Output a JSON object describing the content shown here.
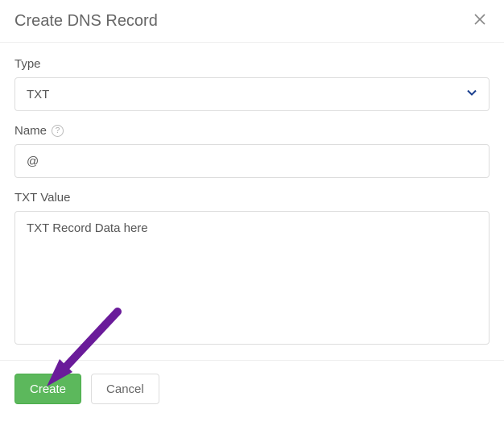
{
  "modal": {
    "title": "Create DNS Record",
    "fields": {
      "type": {
        "label": "Type",
        "value": "TXT"
      },
      "name": {
        "label": "Name",
        "value": "@"
      },
      "txtValue": {
        "label": "TXT Value",
        "value": "TXT Record Data here"
      }
    },
    "buttons": {
      "create": "Create",
      "cancel": "Cancel"
    }
  }
}
